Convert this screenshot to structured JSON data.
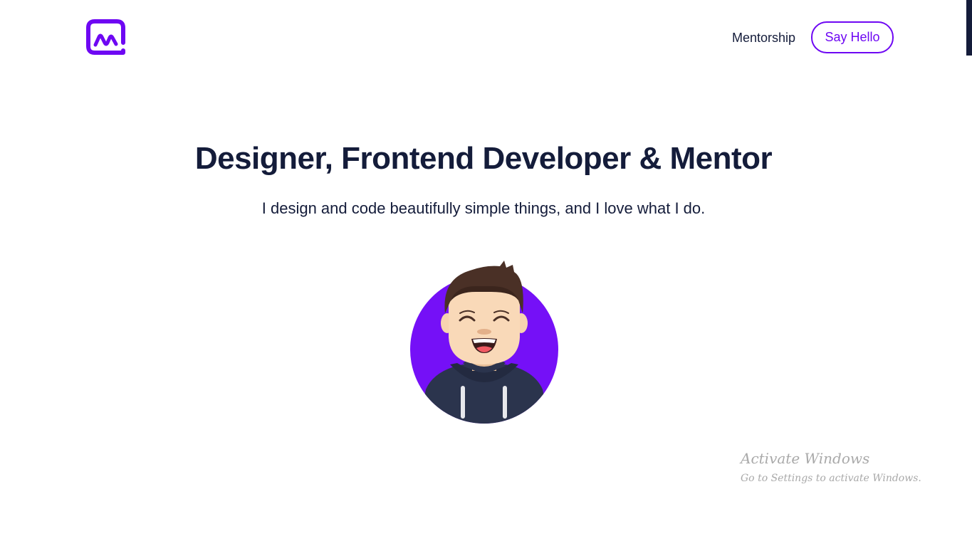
{
  "header": {
    "logo_icon": "mm-logo-icon",
    "nav_link": "Mentorship",
    "cta_button": "Say Hello"
  },
  "hero": {
    "title": "Designer, Frontend Developer & Mentor",
    "subtitle": "I design and code beautifully simple things, and I love what I do.",
    "avatar_icon": "smiling-developer-avatar"
  },
  "os_overlay": {
    "title": "Activate Windows",
    "subtitle": "Go to Settings to activate Windows."
  },
  "colors": {
    "brand": "#6e07f3",
    "text": "#141c3a",
    "background": "#ffffff",
    "overlay_text": "#a9a9a9"
  }
}
